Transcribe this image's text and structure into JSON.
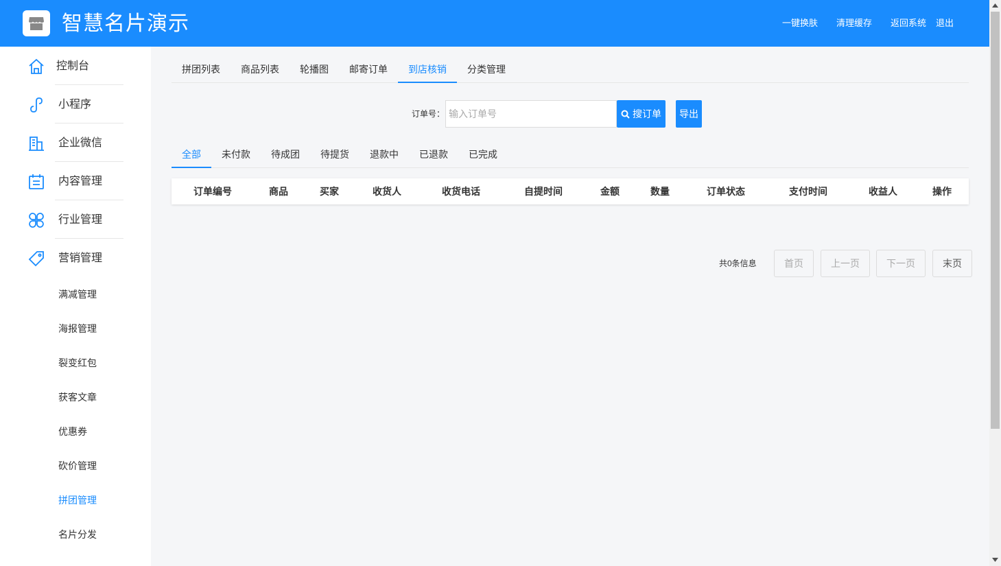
{
  "header": {
    "title": "智慧名片演示",
    "links": [
      "一键换肤",
      "清理缓存",
      "返回系统",
      "退出"
    ]
  },
  "sidebar": {
    "items": [
      {
        "label": "控制台",
        "icon": "home-icon"
      },
      {
        "label": "小程序",
        "icon": "link-icon"
      },
      {
        "label": "企业微信",
        "icon": "building-icon"
      },
      {
        "label": "内容管理",
        "icon": "calendar-icon"
      },
      {
        "label": "行业管理",
        "icon": "grid-clover-icon"
      },
      {
        "label": "营销管理",
        "icon": "tag-icon"
      }
    ],
    "sub_items": [
      "满减管理",
      "海报管理",
      "裂变红包",
      "获客文章",
      "优惠券",
      "砍价管理",
      "拼团管理",
      "名片分发"
    ],
    "active_sub": "拼团管理"
  },
  "tabs": [
    "拼团列表",
    "商品列表",
    "轮播图",
    "邮寄订单",
    "到店核销",
    "分类管理"
  ],
  "active_tab": "到店核销",
  "search": {
    "label": "订单号：",
    "placeholder": "输入订单号",
    "value": "",
    "search_button": "搜订单",
    "export_button": "导出"
  },
  "status_tabs": [
    "全部",
    "未付款",
    "待成团",
    "待提货",
    "退款中",
    "已退款",
    "已完成"
  ],
  "active_status": "全部",
  "table": {
    "columns": [
      "订单编号",
      "商品",
      "买家",
      "收货人",
      "收货电话",
      "自提时间",
      "金额",
      "数量",
      "订单状态",
      "支付时间",
      "收益人",
      "操作"
    ],
    "rows": []
  },
  "pager": {
    "info": "共0条信息",
    "first": "首页",
    "prev": "上一页",
    "next": "下一页",
    "last": "末页"
  },
  "colors": {
    "primary": "#1a8cfe",
    "background": "#f5f6f8"
  }
}
